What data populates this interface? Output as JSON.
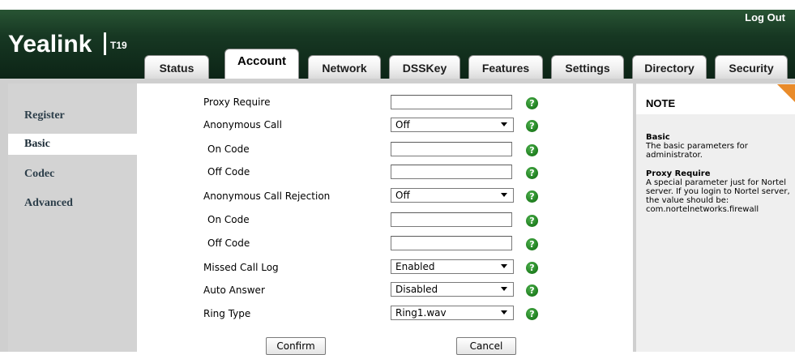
{
  "header": {
    "logo": "Yealink",
    "model": "T19",
    "logout": "Log Out"
  },
  "tabs": [
    {
      "label": "Status"
    },
    {
      "label": "Account",
      "active": true
    },
    {
      "label": "Network"
    },
    {
      "label": "DSSKey"
    },
    {
      "label": "Features"
    },
    {
      "label": "Settings"
    },
    {
      "label": "Directory"
    },
    {
      "label": "Security"
    }
  ],
  "sidebar": {
    "items": [
      {
        "label": "Register"
      },
      {
        "label": "Basic",
        "active": true
      },
      {
        "label": "Codec"
      },
      {
        "label": "Advanced"
      }
    ]
  },
  "form": {
    "proxy_require": {
      "label": "Proxy Require",
      "value": ""
    },
    "anonymous_call": {
      "label": "Anonymous Call",
      "value": "Off"
    },
    "anon_on_code": {
      "label": "On Code",
      "value": ""
    },
    "anon_off_code": {
      "label": "Off Code",
      "value": ""
    },
    "anonymous_call_rejection": {
      "label": "Anonymous Call Rejection",
      "value": "Off"
    },
    "rej_on_code": {
      "label": "On Code",
      "value": ""
    },
    "rej_off_code": {
      "label": "Off Code",
      "value": ""
    },
    "missed_call_log": {
      "label": "Missed Call Log",
      "value": "Enabled"
    },
    "auto_answer": {
      "label": "Auto Answer",
      "value": "Disabled"
    },
    "ring_type": {
      "label": "Ring Type",
      "value": "Ring1.wav"
    },
    "help_glyph": "?",
    "confirm": "Confirm",
    "cancel": "Cancel"
  },
  "note": {
    "title": "NOTE",
    "section1_title": "Basic",
    "section1_text": "The basic parameters for administrator.",
    "section2_title": "Proxy Require",
    "section2_text": "A special parameter just for Nortel server. If you login to Nortel server, the value should be: com.nortelnetworks.firewall"
  },
  "colors": {
    "header_dark": "#173823",
    "frame_gray": "#cfcfcf",
    "help_green": "#1d7d1d",
    "note_corner": "#e98b2a"
  }
}
